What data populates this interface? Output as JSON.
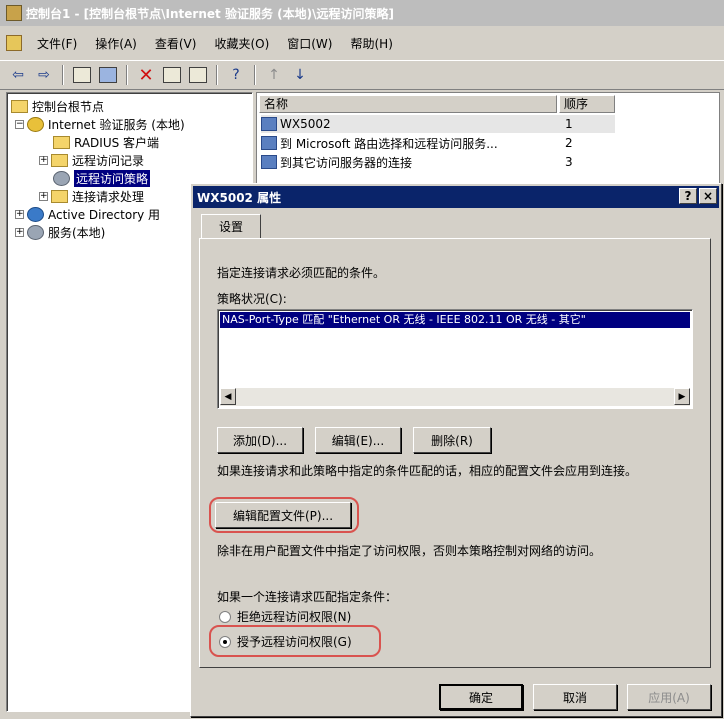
{
  "window": {
    "title": "控制台1 - [控制台根节点\\Internet 验证服务 (本地)\\远程访问策略]"
  },
  "menu": [
    "文件(F)",
    "操作(A)",
    "查看(V)",
    "收藏夹(O)",
    "窗口(W)",
    "帮助(H)"
  ],
  "toolbar": {
    "back": "⇦",
    "forward": "⇨",
    "up": "↑",
    "down": "↓",
    "delete": "✕",
    "help": "?"
  },
  "tree": {
    "items": [
      {
        "label": "控制台根节点"
      },
      {
        "label": "Internet 验证服务 (本地)"
      },
      {
        "label": "RADIUS 客户端"
      },
      {
        "label": "远程访问记录"
      },
      {
        "label": "远程访问策略"
      },
      {
        "label": "连接请求处理"
      },
      {
        "label": "Active Directory 用"
      },
      {
        "label": "服务(本地)"
      }
    ]
  },
  "list": {
    "columns": [
      "名称",
      "顺序"
    ],
    "rows": [
      {
        "name": "WX5002",
        "order": "1"
      },
      {
        "name": "到 Microsoft 路由选择和远程访问服务...",
        "order": "2"
      },
      {
        "name": "到其它访问服务器的连接",
        "order": "3"
      }
    ]
  },
  "dialog": {
    "title": "WX5002 属性",
    "help_btn": "?",
    "close_btn": "×",
    "tab": "设置",
    "instruction": "指定连接请求必须匹配的条件。",
    "policy_label": "策略状况(C):",
    "condition": "NAS-Port-Type 匹配 \"Ethernet OR 无线 - IEEE 802.11 OR 无线 - 其它\"",
    "add_btn": "添加(D)...",
    "edit_btn": "编辑(E)...",
    "remove_btn": "删除(R)",
    "match_note": "如果连接请求和此策略中指定的条件匹配的话，相应的配置文件会应用到连接。",
    "edit_profile_btn": "编辑配置文件(P)...",
    "profile_note": "除非在用户配置文件中指定了访问权限，否则本策略控制对网络的访问。",
    "if_match_label": "如果一个连接请求匹配指定条件：",
    "deny_label": "拒绝远程访问权限(N)",
    "grant_label": "授予远程访问权限(G)",
    "ok_btn": "确定",
    "cancel_btn": "取消",
    "apply_btn": "应用(A)"
  }
}
